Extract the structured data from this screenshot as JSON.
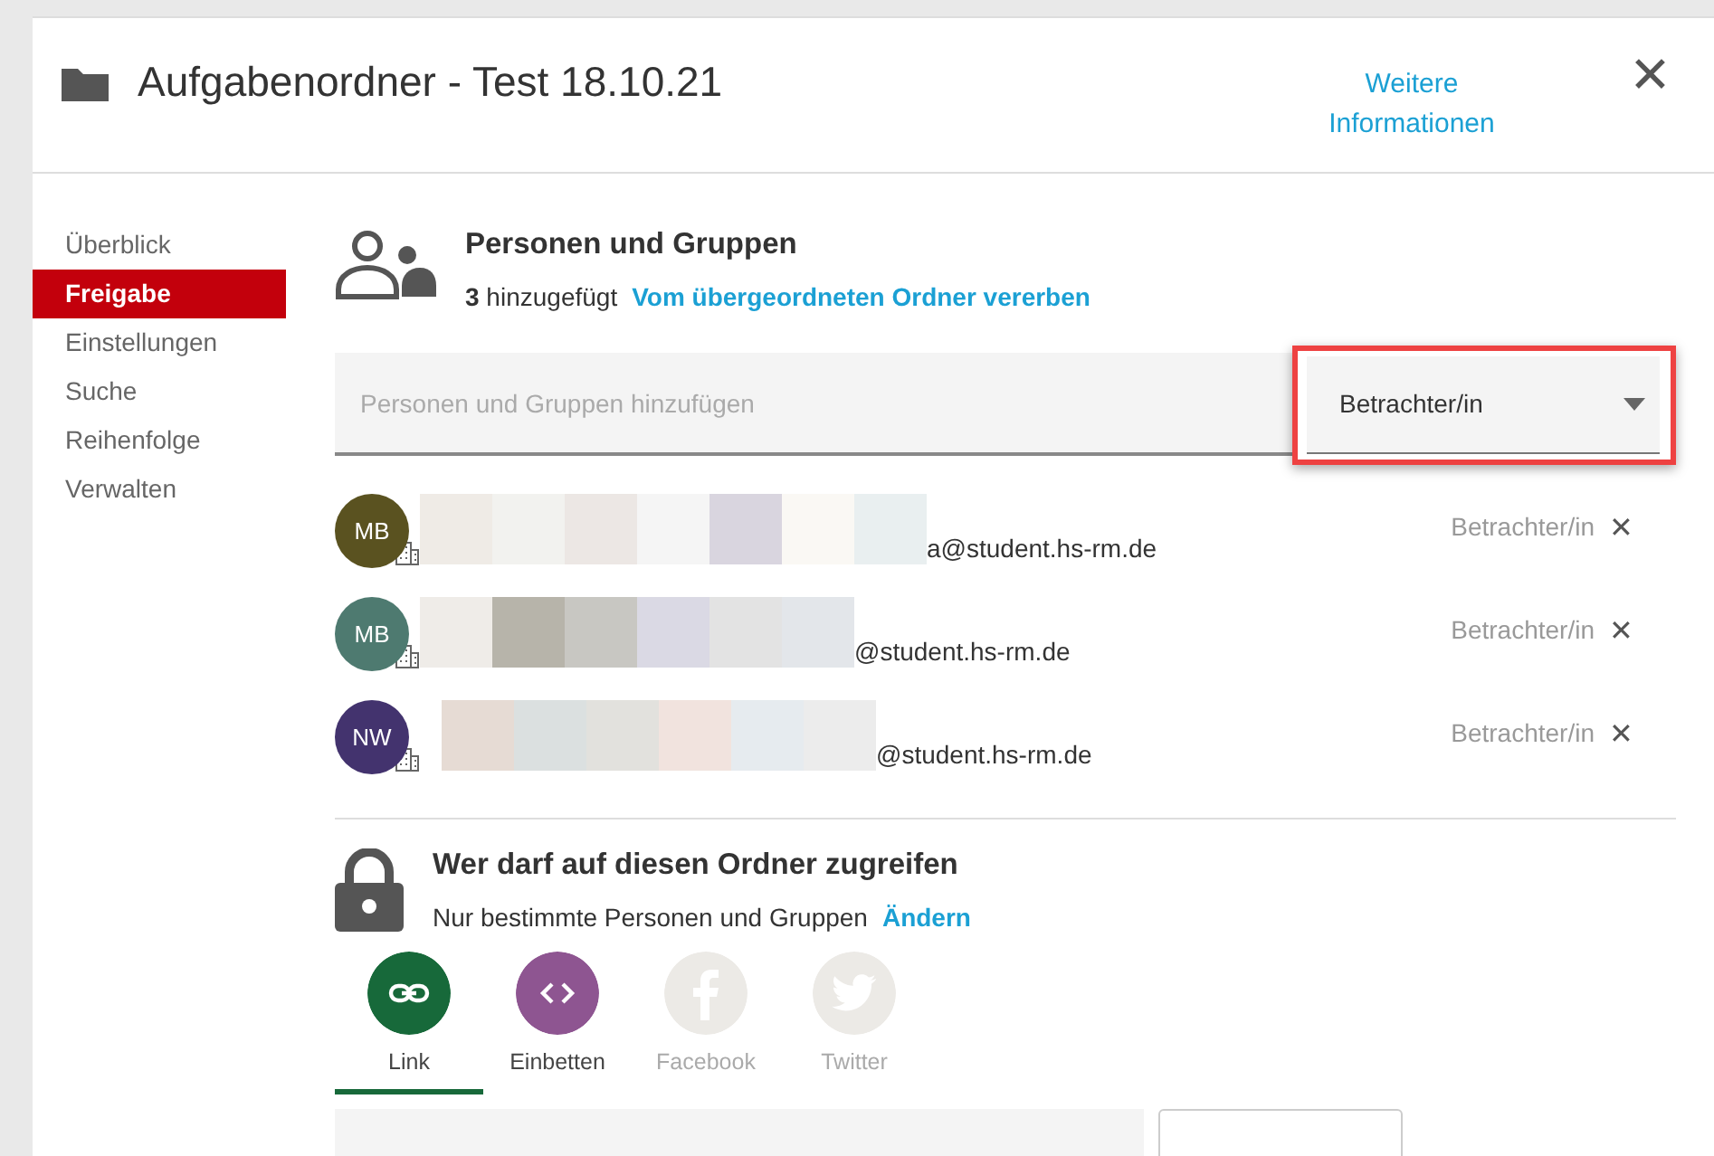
{
  "window": {
    "title": "Aufgabenordner - Test 18.10.21",
    "info_link": "Weitere Informationen",
    "close": "✕"
  },
  "sidebar": {
    "items": [
      {
        "label": "Überblick",
        "selected": false
      },
      {
        "label": "Freigabe",
        "selected": true
      },
      {
        "label": "Einstellungen",
        "selected": false
      },
      {
        "label": "Suche",
        "selected": false
      },
      {
        "label": "Reihenfolge",
        "selected": false
      },
      {
        "label": "Verwalten",
        "selected": false
      }
    ]
  },
  "people": {
    "title": "Personen und Gruppen",
    "count": "3",
    "count_label": "hinzugefügt",
    "inherit_link": "Vom übergeordneten Ordner vererben",
    "add_field": {
      "placeholder": "Personen und Gruppen hinzufügen"
    },
    "role_select": {
      "value": "Betrachter/in",
      "highlighted": true
    },
    "members": [
      {
        "initials": "MB",
        "color": "#5a5220",
        "email": "a@student.hs-rm.de",
        "role": "Betrachter/in"
      },
      {
        "initials": "MB",
        "color": "#4e7a70",
        "email": "@student.hs-rm.de",
        "role": "Betrachter/in"
      },
      {
        "initials": "NW",
        "color": "#43336e",
        "email": "@student.hs-rm.de",
        "role": "Betrachter/in"
      }
    ]
  },
  "access": {
    "title": "Wer darf auf diesen Ordner zugreifen",
    "subtitle": "Nur bestimmte Personen und Gruppen",
    "change_link": "Ändern"
  },
  "share_options": [
    {
      "kind": "link",
      "label": "Link",
      "selected": true,
      "disabled": false,
      "color": "#17693a"
    },
    {
      "kind": "embed",
      "label": "Einbetten",
      "selected": false,
      "disabled": false,
      "color": "#8e5591"
    },
    {
      "kind": "facebook",
      "label": "Facebook",
      "selected": false,
      "disabled": true,
      "color": "#eceae6"
    },
    {
      "kind": "twitter",
      "label": "Twitter",
      "selected": false,
      "disabled": true,
      "color": "#eceae6"
    }
  ]
}
